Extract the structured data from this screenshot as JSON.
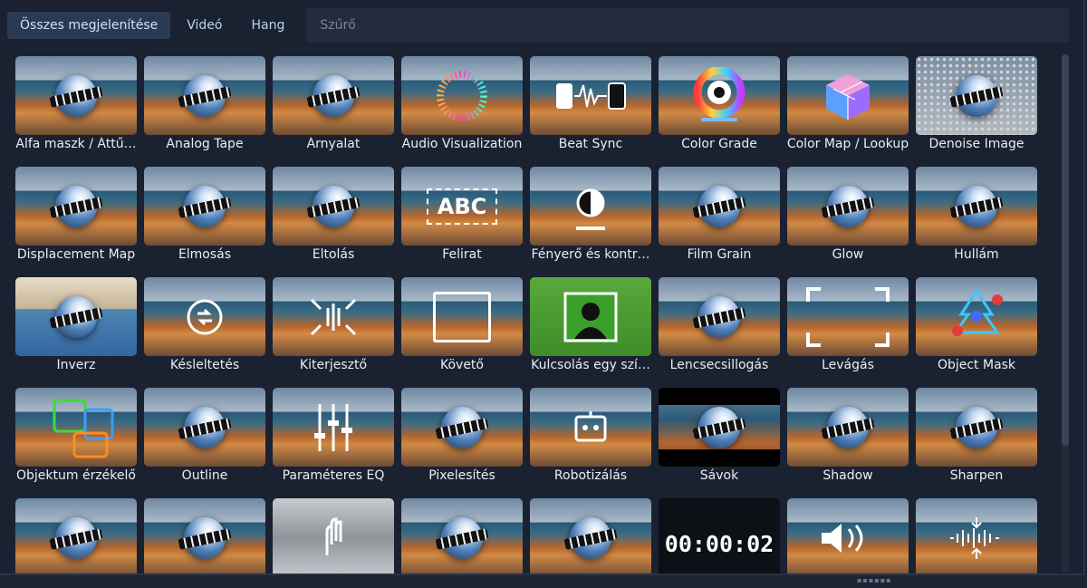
{
  "tabs": [
    {
      "label": "Összes megjelenítése",
      "active": true
    },
    {
      "label": "Videó",
      "active": false
    },
    {
      "label": "Hang",
      "active": false
    }
  ],
  "filter": {
    "placeholder": "Szűrő",
    "value": ""
  },
  "effects": [
    {
      "label": "Alfa maszk / Áttű…",
      "icon": "alpha-mask-icon"
    },
    {
      "label": "Analog Tape",
      "icon": "analog-tape-icon"
    },
    {
      "label": "Árnyalat",
      "icon": "hue-icon"
    },
    {
      "label": "Audio Visualization",
      "icon": "audio-visualization-icon"
    },
    {
      "label": "Beat Sync",
      "icon": "beat-sync-icon"
    },
    {
      "label": "Color Grade",
      "icon": "color-grade-icon"
    },
    {
      "label": "Color Map / Lookup",
      "icon": "color-map-icon"
    },
    {
      "label": "Denoise Image",
      "icon": "denoise-icon"
    },
    {
      "label": "Displacement Map",
      "icon": "displacement-map-icon"
    },
    {
      "label": "Elmosás",
      "icon": "blur-icon"
    },
    {
      "label": "Eltolás",
      "icon": "offset-icon"
    },
    {
      "label": "Felirat",
      "icon": "caption-icon",
      "overlay_text": "ABC"
    },
    {
      "label": "Fényerő és kontr…",
      "icon": "brightness-contrast-icon"
    },
    {
      "label": "Film Grain",
      "icon": "film-grain-icon"
    },
    {
      "label": "Glow",
      "icon": "glow-icon"
    },
    {
      "label": "Hullám",
      "icon": "wave-icon"
    },
    {
      "label": "Inverz",
      "icon": "invert-icon"
    },
    {
      "label": "Késleltetés",
      "icon": "delay-icon"
    },
    {
      "label": "Kiterjesztő",
      "icon": "expander-icon"
    },
    {
      "label": "Követő",
      "icon": "tracker-icon"
    },
    {
      "label": "Kulcsolás egy szí…",
      "icon": "chroma-key-icon"
    },
    {
      "label": "Lencsecsillogás",
      "icon": "lens-flare-icon"
    },
    {
      "label": "Levágás",
      "icon": "crop-icon"
    },
    {
      "label": "Object Mask",
      "icon": "object-mask-icon"
    },
    {
      "label": "Objektum érzékelő",
      "icon": "object-detector-icon"
    },
    {
      "label": "Outline",
      "icon": "outline-icon"
    },
    {
      "label": "Paraméteres EQ",
      "icon": "parametric-eq-icon"
    },
    {
      "label": "Pixelesítés",
      "icon": "pixelate-icon"
    },
    {
      "label": "Robotizálás",
      "icon": "robot-icon"
    },
    {
      "label": "Sávok",
      "icon": "bars-icon"
    },
    {
      "label": "Shadow",
      "icon": "shadow-icon"
    },
    {
      "label": "Sharpen",
      "icon": "sharpen-icon"
    },
    {
      "label": "",
      "icon": "spherical-icon"
    },
    {
      "label": "",
      "icon": "stabilizer-icon"
    },
    {
      "label": "",
      "icon": "gesture-icon"
    },
    {
      "label": "",
      "icon": "rgb-split-icon"
    },
    {
      "label": "",
      "icon": "wipe-icon"
    },
    {
      "label": "",
      "icon": "timer-icon",
      "overlay_text": "00:00:02"
    },
    {
      "label": "",
      "icon": "volume-icon"
    },
    {
      "label": "",
      "icon": "whisper-icon"
    }
  ],
  "colors": {
    "background": "#1a2231",
    "tab_active": "#2a3a52",
    "filter_bg": "#222c3c"
  }
}
